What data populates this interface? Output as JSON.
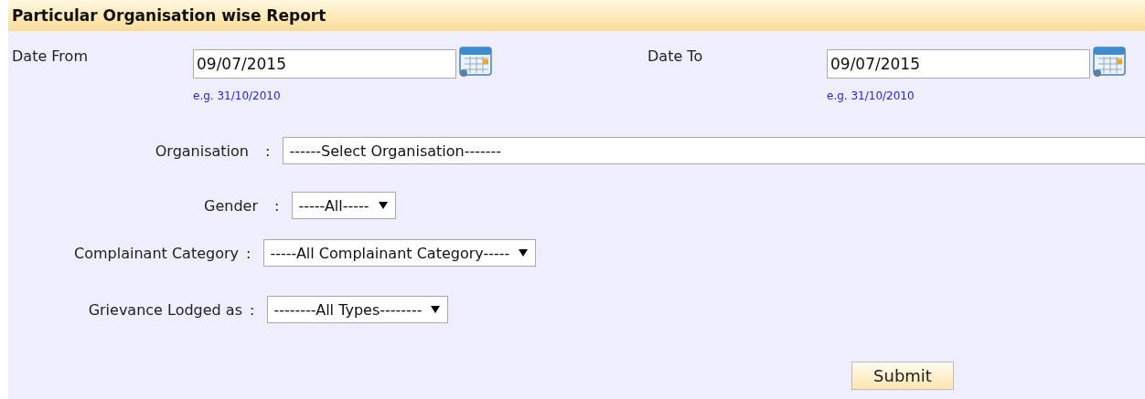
{
  "title": "Particular Organisation wise Report",
  "dates": [
    {
      "label": "Date From",
      "value": "09/07/2015",
      "hint": "e.g. 31/10/2010"
    },
    {
      "label": "Date To",
      "value": "09/07/2015",
      "hint": "e.g. 31/10/2010"
    }
  ],
  "selects": [
    {
      "label": "Organisation",
      "colon": ":",
      "value": "------Select Organisation-------",
      "caret": false
    },
    {
      "label": "Gender",
      "colon": ":",
      "value": "-----All-----",
      "caret": true
    },
    {
      "label": "Complainant Category",
      "colon": ":",
      "value": "-----All Complainant Category-----",
      "caret": true
    },
    {
      "label": "Grievance Lodged as",
      "colon": ":",
      "value": "--------All Types--------",
      "caret": true
    }
  ],
  "submit": "Submit"
}
